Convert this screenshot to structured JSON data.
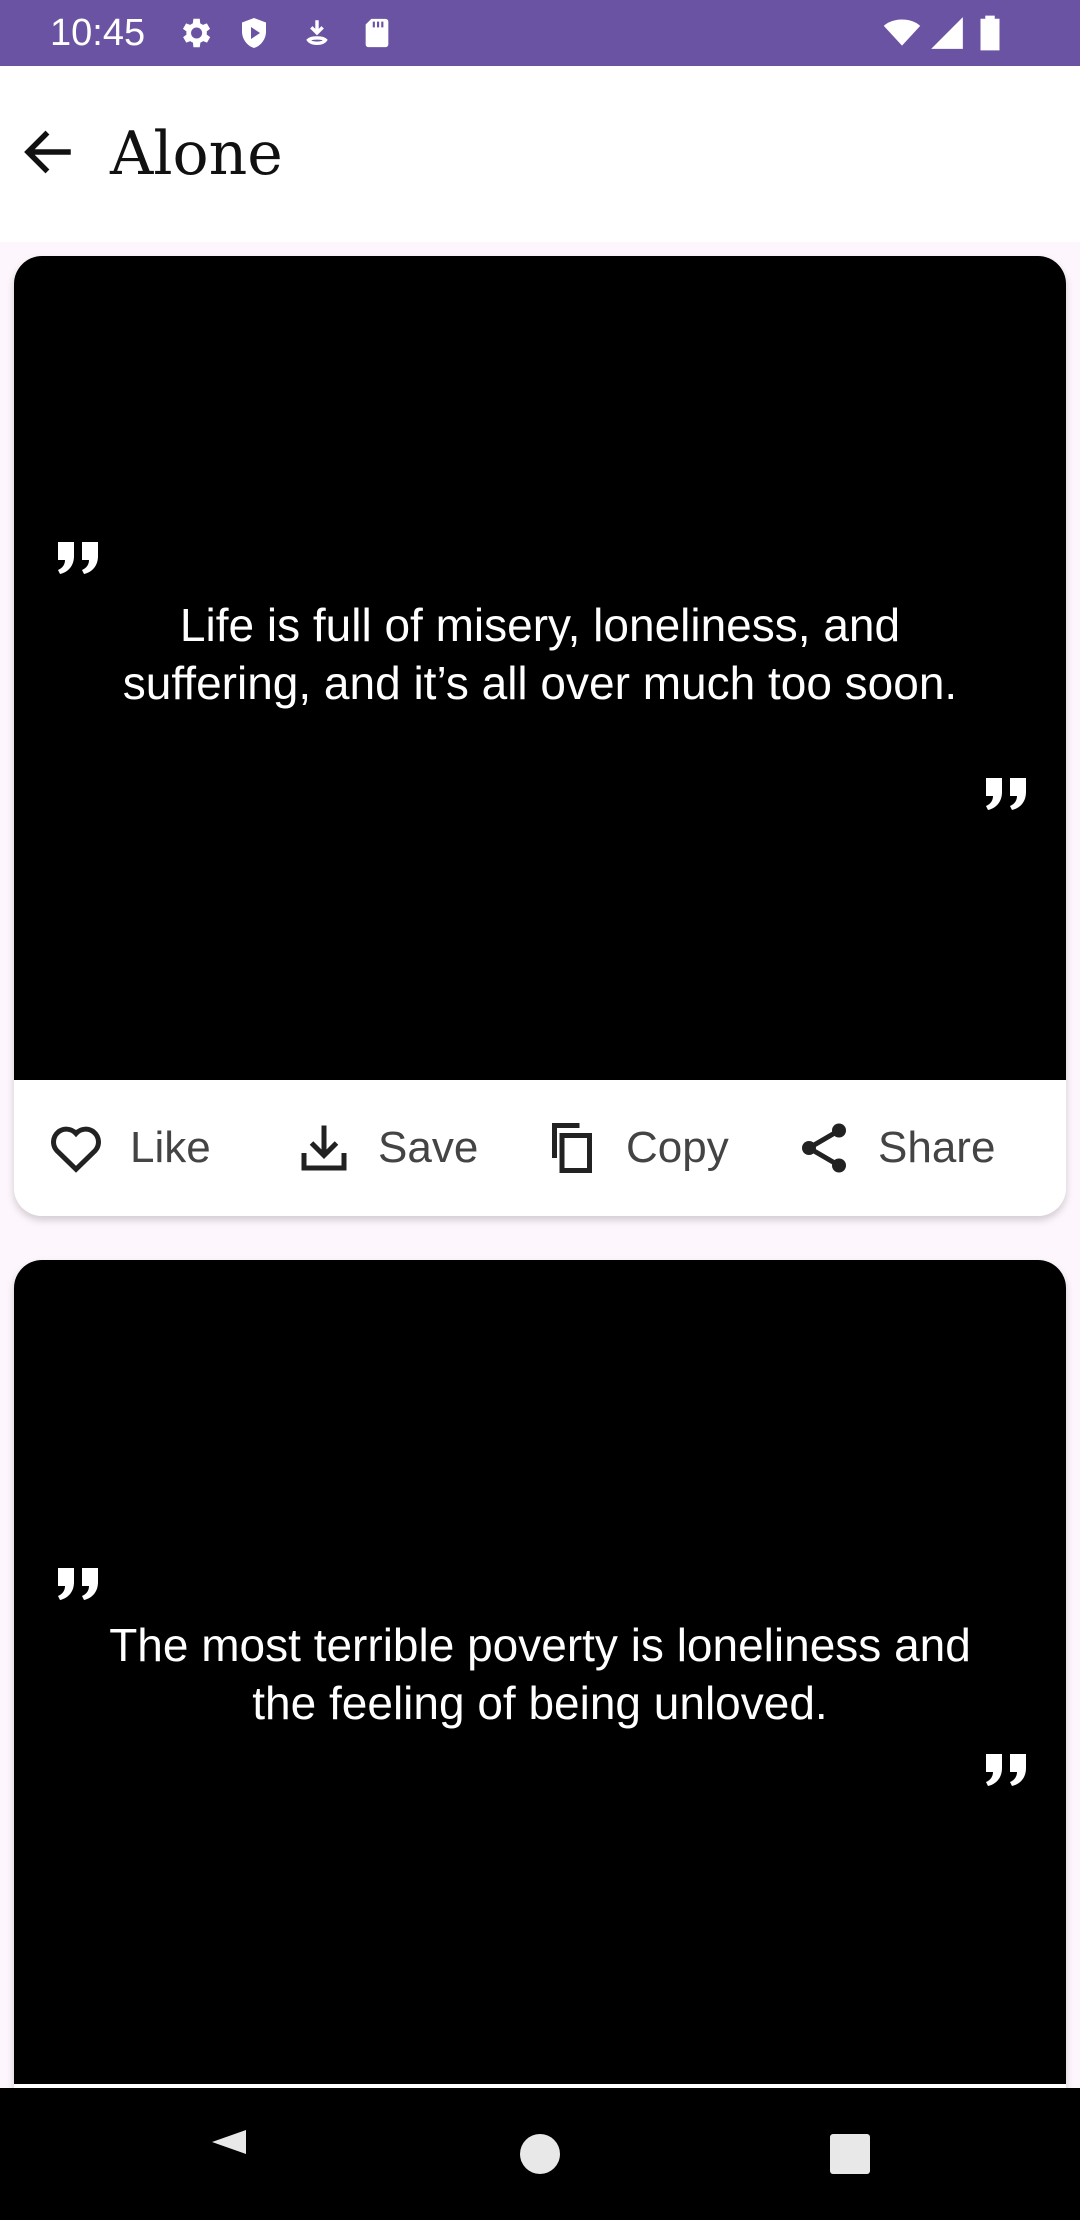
{
  "status_bar": {
    "time": "10:45",
    "left_icons": [
      "gear-icon",
      "shield-play-icon",
      "download-icon",
      "sd-card-icon"
    ],
    "right_icons": [
      "wifi-icon",
      "signal-icon",
      "battery-icon"
    ],
    "color": "#6b53a3"
  },
  "app_bar": {
    "title": "Alone",
    "back_icon": "arrow-left-icon"
  },
  "quotes": [
    {
      "text": "Life is full of misery, loneliness, and suffering, and it’s all over much too soon.",
      "actions": {
        "like": "Like",
        "save": "Save",
        "copy": "Copy",
        "share": "Share"
      }
    },
    {
      "text": "The most terrible poverty is loneliness and the feeling of being unloved."
    }
  ],
  "nav_bar": {
    "buttons": [
      "back-triangle-icon",
      "home-circle-icon",
      "recents-square-icon"
    ]
  }
}
